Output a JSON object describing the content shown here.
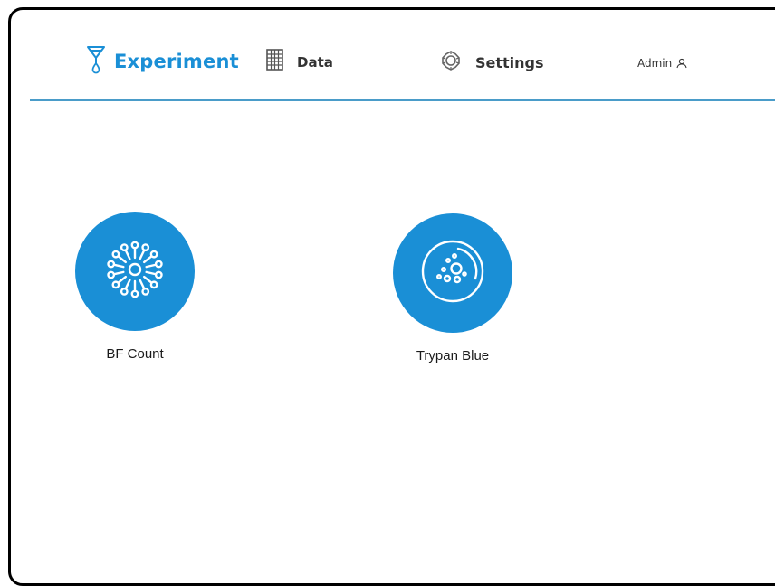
{
  "nav": {
    "items": [
      {
        "label": "Experiment",
        "icon": "funnel-drop-icon",
        "active": true
      },
      {
        "label": "Data",
        "icon": "grid-table-icon",
        "active": false
      },
      {
        "label": "Settings",
        "icon": "gear-icon",
        "active": false
      }
    ],
    "user": {
      "label": "Admin",
      "icon": "user-icon"
    }
  },
  "experiments": [
    {
      "label": "BF Count",
      "icon": "cell-count-icon"
    },
    {
      "label": "Trypan Blue",
      "icon": "petri-dish-icon"
    }
  ],
  "colors": {
    "accent": "#1a8fd6",
    "divider": "#4a9cc9",
    "text": "#333333"
  }
}
